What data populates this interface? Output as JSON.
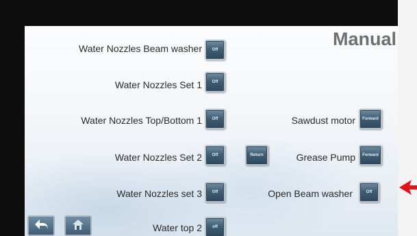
{
  "header": {
    "title": "Manual"
  },
  "left_column": [
    {
      "label": "Water Nozzles Beam washer",
      "state": "Off"
    },
    {
      "label": "Water Nozzles Set 1",
      "state": "Off"
    },
    {
      "label": "Water Nozzles Top/Bottom 1",
      "state": "Off"
    },
    {
      "label": "Water Nozzles Set 2",
      "state": "Off"
    },
    {
      "label": "Water Nozzles set 3",
      "state": "Off"
    },
    {
      "label": "Water top 2",
      "state": "off"
    }
  ],
  "right_column": [
    {
      "label": "Sawdust motor",
      "state": "Forward"
    },
    {
      "label": "Grease Pump",
      "state": "Forward",
      "extra_button": "Return"
    },
    {
      "label": "Open Beam washer",
      "state": "Off"
    }
  ],
  "nav": {
    "back_icon": "back-arrow-icon",
    "home_icon": "home-icon"
  },
  "colors": {
    "button": "#3f5d73",
    "accent": "#e0151a",
    "title": "#6f6f6f"
  }
}
